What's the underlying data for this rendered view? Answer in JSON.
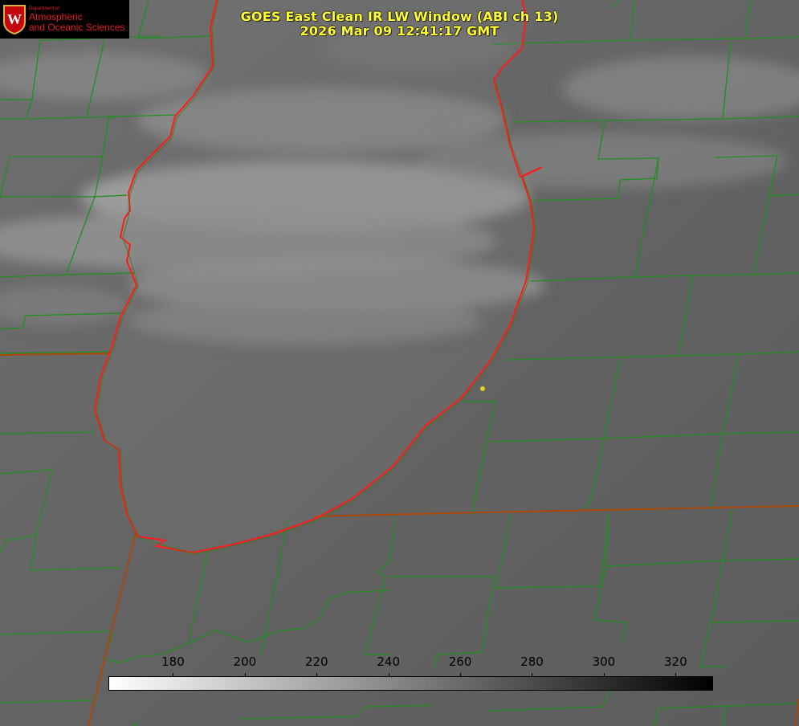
{
  "title_line1": "GOES East Clean IR LW Window (ABI ch 13)",
  "title_line2": "2026 Mar 09 12:41:17 GMT",
  "logo": {
    "department": "Department of",
    "line1": "Atmospheric",
    "line2": "and Oceanic Sciences",
    "seal_letter": "W",
    "color": "#e31b23"
  },
  "colorbar": {
    "ticks": [
      "180",
      "200",
      "220",
      "240",
      "260",
      "280",
      "300",
      "320"
    ],
    "tick_values": [
      180,
      200,
      220,
      240,
      260,
      280,
      300,
      320
    ],
    "min": 162,
    "max": 330,
    "gradient_from": "#ffffff",
    "gradient_to": "#000000"
  },
  "colors": {
    "title": "#ffff33",
    "county_lines": "#1f8f1f",
    "coastline": "#ff1a1a",
    "state_line": "#b34400",
    "marker": "#e6d21a"
  }
}
